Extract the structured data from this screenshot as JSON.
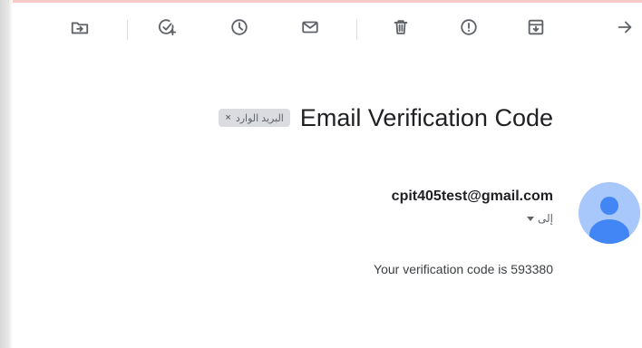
{
  "colors": {
    "icon_gray": "#5f6368",
    "label_chip_bg": "#dadce0",
    "avatar_bg": "#a8c7fa",
    "avatar_fg": "#4285f4"
  },
  "toolbar": {
    "icons": [
      "move-to-folder-icon",
      "add-to-tasks-icon",
      "snooze-icon",
      "mark-unread-icon",
      "delete-icon",
      "report-spam-icon",
      "archive-icon",
      "next-arrow-icon"
    ]
  },
  "email": {
    "subject": "Email Verification Code",
    "label": {
      "text": "البريد الوارد",
      "remove_glyph": "×"
    },
    "sender": "cpit405test@gmail.com",
    "recipient": "إلى",
    "body": "Your verification code is 593380"
  }
}
